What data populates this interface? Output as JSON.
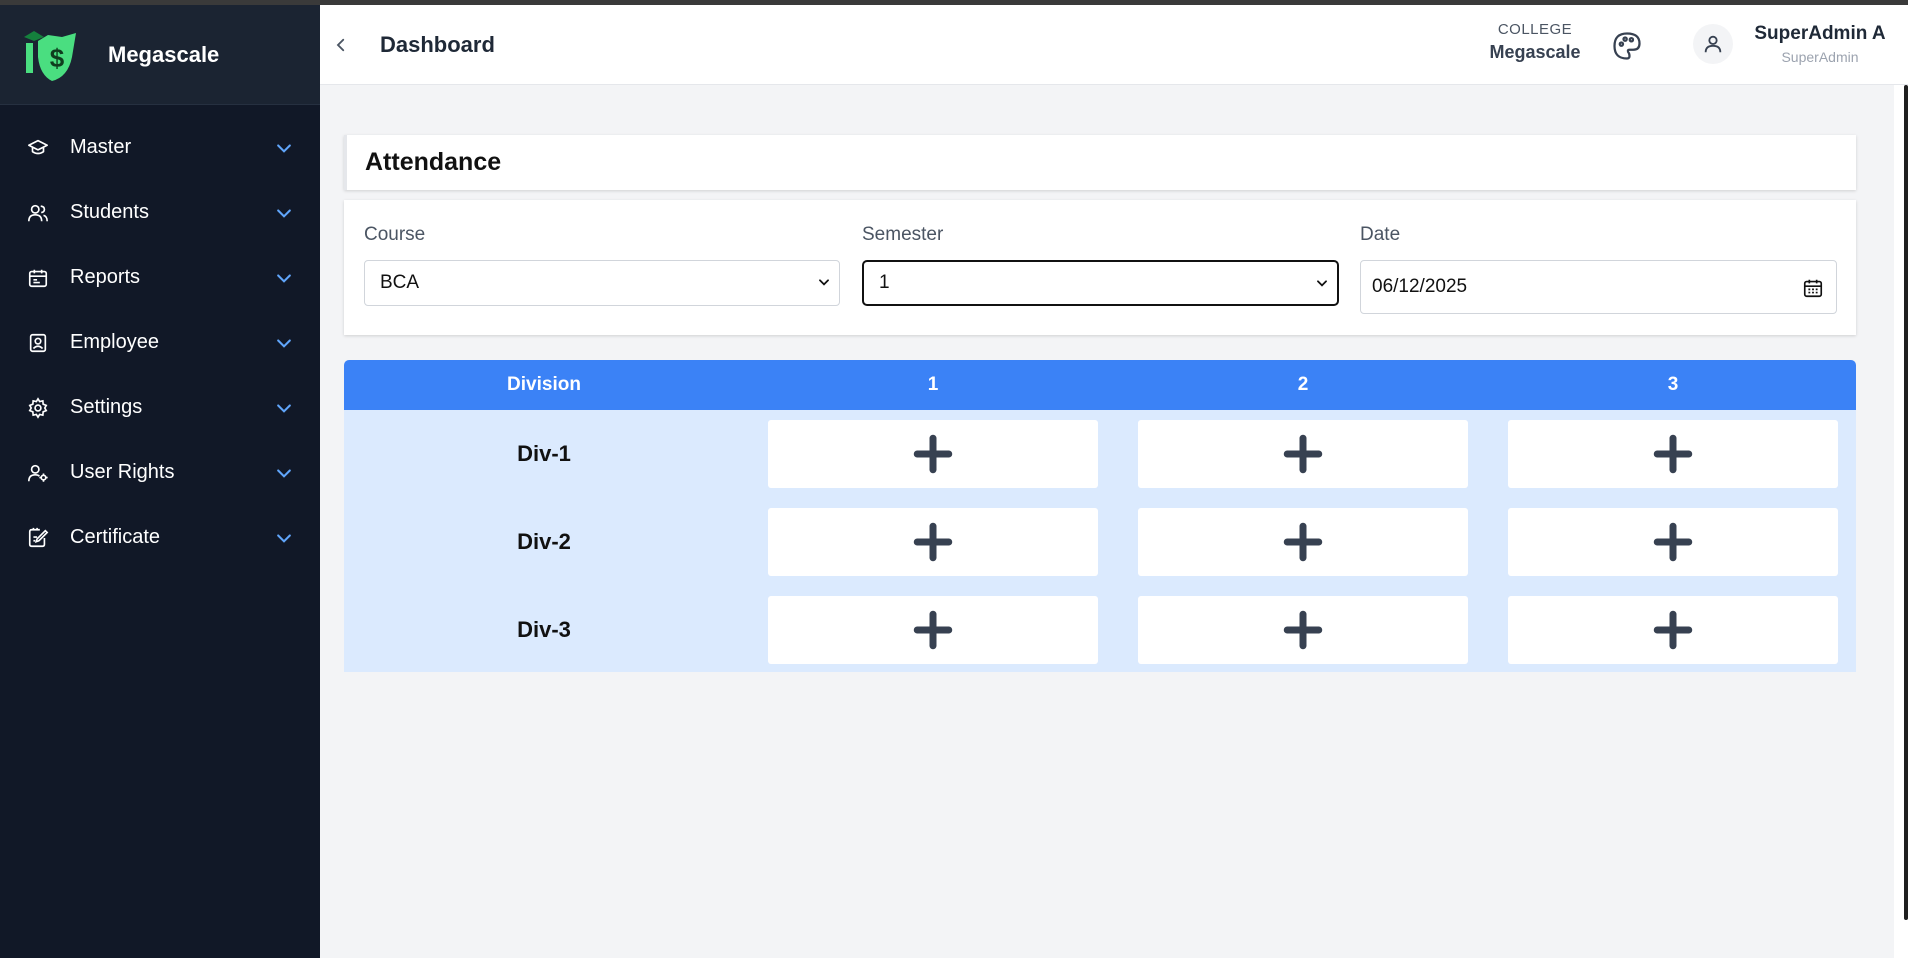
{
  "brand": {
    "name": "Megascale"
  },
  "sidebar": {
    "items": [
      {
        "label": "Master",
        "icon": "graduation-cap-icon"
      },
      {
        "label": "Students",
        "icon": "users-icon"
      },
      {
        "label": "Reports",
        "icon": "calendar-report-icon"
      },
      {
        "label": "Employee",
        "icon": "id-badge-icon"
      },
      {
        "label": "Settings",
        "icon": "gear-icon"
      },
      {
        "label": "User Rights",
        "icon": "user-cog-icon"
      },
      {
        "label": "Certificate",
        "icon": "certificate-edit-icon"
      }
    ]
  },
  "header": {
    "title": "Dashboard",
    "college_label": "COLLEGE",
    "college_name": "Megascale",
    "user_name": "SuperAdmin A",
    "user_role": "SuperAdmin"
  },
  "attendance": {
    "title": "Attendance",
    "course": {
      "label": "Course",
      "value": "BCA"
    },
    "semester": {
      "label": "Semester",
      "value": "1"
    },
    "date": {
      "label": "Date",
      "value": "06/12/2025"
    },
    "table": {
      "headers": [
        "Division",
        "1",
        "2",
        "3"
      ],
      "rows": [
        {
          "division": "Div-1"
        },
        {
          "division": "Div-2"
        },
        {
          "division": "Div-3"
        }
      ]
    }
  },
  "colors": {
    "sidebar_bg": "#111827",
    "accent_blue": "#3b82f6",
    "row_bg": "#dbeafe",
    "chevron_blue": "#60a5fa",
    "logo_green": "#4ade80"
  }
}
